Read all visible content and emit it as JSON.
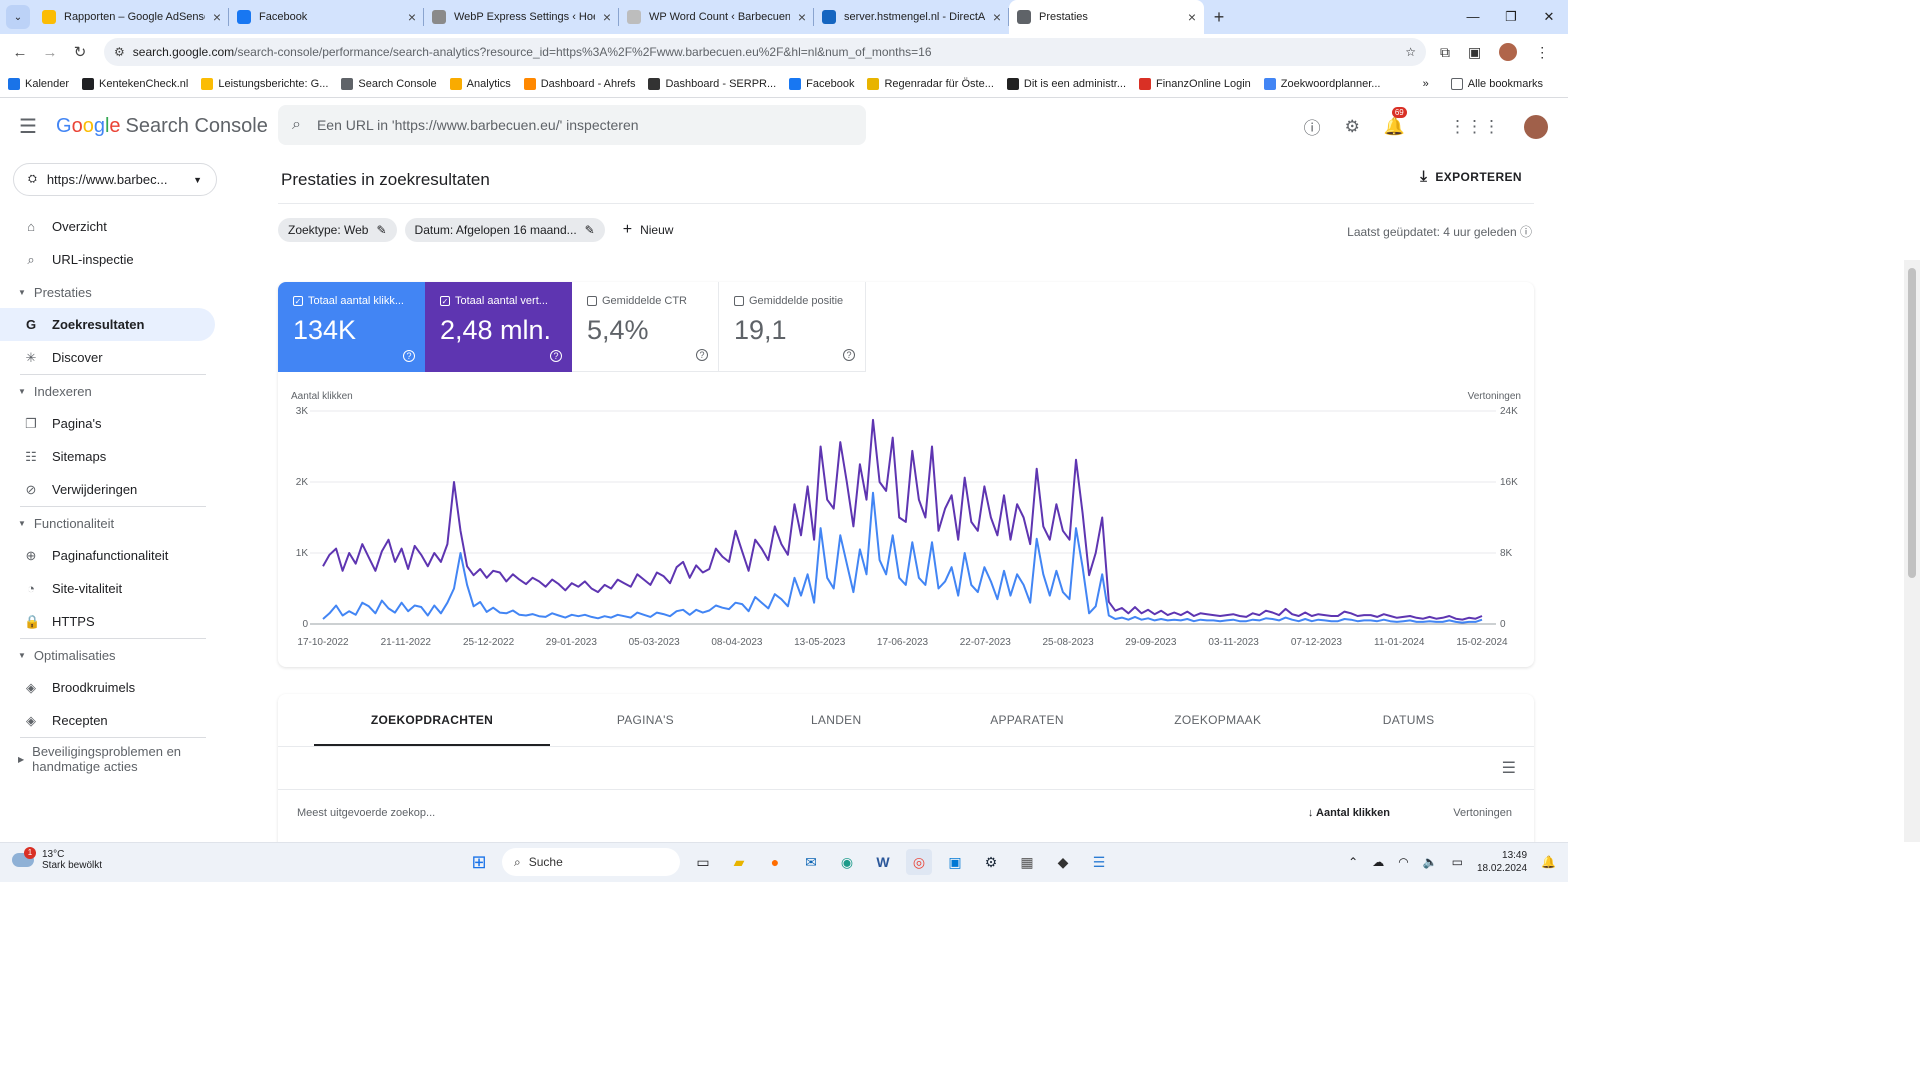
{
  "browser": {
    "tabs": [
      {
        "title": "Rapporten – Google AdSense",
        "color": "#fbbc04",
        "active": false
      },
      {
        "title": "Facebook",
        "color": "#1877f2",
        "active": false
      },
      {
        "title": "WebP Express Settings ‹ Hoe la",
        "color": "#8a8a8a",
        "active": false
      },
      {
        "title": "WP Word Count ‹ Barbecuen.eu",
        "color": "#bdbdbd",
        "active": false
      },
      {
        "title": "server.hstmengel.nl - DirectAdm",
        "color": "#1565c0",
        "active": false
      },
      {
        "title": "Prestaties",
        "color": "#5f6368",
        "active": true
      }
    ],
    "url_host": "search.google.com",
    "url_path": "/search-console/performance/search-analytics?resource_id=https%3A%2F%2Fwww.barbecuen.eu%2F&hl=nl&num_of_months=16",
    "bookmarks": [
      {
        "label": "Kalender",
        "color": "#1a73e8"
      },
      {
        "label": "KentekenCheck.nl",
        "color": "#202124"
      },
      {
        "label": "Leistungsberichte: G...",
        "color": "#fbbc04"
      },
      {
        "label": "Search Console",
        "color": "#5f6368"
      },
      {
        "label": "Analytics",
        "color": "#f9ab00"
      },
      {
        "label": "Dashboard - Ahrefs",
        "color": "#ff8800"
      },
      {
        "label": "Dashboard - SERPR...",
        "color": "#333333"
      },
      {
        "label": "Facebook",
        "color": "#1877f2"
      },
      {
        "label": "Regenradar für Öste...",
        "color": "#e8b400"
      },
      {
        "label": "Dit is een administr...",
        "color": "#222222"
      },
      {
        "label": "FinanzOnline Login",
        "color": "#d93025"
      },
      {
        "label": "Zoekwoordplanner...",
        "color": "#4285f4"
      }
    ],
    "all_bookmarks": "Alle bookmarks"
  },
  "header": {
    "logo_google": "Google",
    "logo_product": "Search Console",
    "search_placeholder": "Een URL in 'https://www.barbecuen.eu/' inspecteren",
    "notifications": "69"
  },
  "sidebar": {
    "property": "https://www.barbec...",
    "items": [
      {
        "type": "item",
        "label": "Overzicht",
        "icon": "home-icon",
        "glyph": "⌂"
      },
      {
        "type": "item",
        "label": "URL-inspectie",
        "icon": "search-icon",
        "glyph": "⌕"
      },
      {
        "type": "section",
        "label": "Prestaties"
      },
      {
        "type": "item",
        "label": "Zoekresultaten",
        "icon": "google-g-icon",
        "glyph": "G",
        "active": true
      },
      {
        "type": "item",
        "label": "Discover",
        "icon": "asterisk-icon",
        "glyph": "✳"
      },
      {
        "type": "section",
        "label": "Indexeren"
      },
      {
        "type": "item",
        "label": "Pagina's",
        "icon": "pages-icon",
        "glyph": "❐"
      },
      {
        "type": "item",
        "label": "Sitemaps",
        "icon": "sitemap-icon",
        "glyph": "☷"
      },
      {
        "type": "item",
        "label": "Verwijderingen",
        "icon": "eye-off-icon",
        "glyph": "⊘"
      },
      {
        "type": "section",
        "label": "Functionaliteit"
      },
      {
        "type": "item",
        "label": "Paginafunctionaliteit",
        "icon": "plus-circle-icon",
        "glyph": "⊕"
      },
      {
        "type": "item",
        "label": "Site-vitaliteit",
        "icon": "speed-icon",
        "glyph": "◔"
      },
      {
        "type": "item",
        "label": "HTTPS",
        "icon": "lock-icon",
        "glyph": "🔒"
      },
      {
        "type": "section",
        "label": "Optimalisaties"
      },
      {
        "type": "item",
        "label": "Broodkruimels",
        "icon": "layers-icon",
        "glyph": "◈"
      },
      {
        "type": "item",
        "label": "Recepten",
        "icon": "layers-icon",
        "glyph": "◈"
      },
      {
        "type": "section",
        "label": "Beveiligingsproblemen en handmatige acties"
      }
    ]
  },
  "main": {
    "title": "Prestaties in zoekresultaten",
    "export": "EXPORTEREN",
    "filters": [
      "Zoektype: Web",
      "Datum: Afgelopen 16 maand..."
    ],
    "new_label": "Nieuw",
    "updated": "Laatst geüpdatet: 4 uur geleden",
    "metrics": [
      {
        "label": "Totaal aantal klikk...",
        "value": "134K",
        "checked": true,
        "color": "#4285f4"
      },
      {
        "label": "Totaal aantal vert...",
        "value": "2,48 mln.",
        "checked": true,
        "color": "#5e35b1"
      },
      {
        "label": "Gemiddelde CTR",
        "value": "5,4%",
        "checked": false
      },
      {
        "label": "Gemiddelde positie",
        "value": "19,1",
        "checked": false
      }
    ],
    "tabs": [
      "ZOEKOPDRACHTEN",
      "PAGINA'S",
      "LANDEN",
      "APPARATEN",
      "ZOEKOPMAAK",
      "DATUMS"
    ],
    "table": {
      "col_query": "Meest uitgevoerde zoekop...",
      "col_clicks": "Aantal klikken",
      "col_impr": "Vertoningen"
    }
  },
  "chart_data": {
    "type": "line",
    "ylabel_left": "Aantal klikken",
    "ylabel_right": "Vertoningen",
    "ylim_left": [
      0,
      3000
    ],
    "ylim_right": [
      0,
      24000
    ],
    "yticks_left": [
      "0",
      "1K",
      "2K",
      "3K"
    ],
    "yticks_right": [
      "0",
      "8K",
      "16K",
      "24K"
    ],
    "xticks": [
      "17-10-2022",
      "21-11-2022",
      "25-12-2022",
      "29-01-2023",
      "05-03-2023",
      "08-04-2023",
      "13-05-2023",
      "17-06-2023",
      "22-07-2023",
      "25-08-2023",
      "29-09-2023",
      "03-11-2023",
      "07-12-2023",
      "11-01-2024",
      "15-02-2024"
    ],
    "grid": true,
    "series": [
      {
        "axis": "right",
        "color": "#5e35b1",
        "values": [
          6500,
          7800,
          8500,
          6000,
          8000,
          6800,
          9000,
          7500,
          6000,
          8200,
          9500,
          7000,
          8500,
          6200,
          8800,
          7800,
          6500,
          8000,
          7000,
          9000,
          16000,
          10500,
          6500,
          5500,
          6200,
          5200,
          6000,
          5800,
          4800,
          5600,
          5000,
          4500,
          5200,
          4800,
          4200,
          5000,
          4500,
          3800,
          4600,
          4200,
          4800,
          4000,
          3600,
          4400,
          4000,
          5000,
          4600,
          4200,
          5600,
          5000,
          4400,
          5800,
          5400,
          4600,
          6400,
          7000,
          5200,
          6600,
          5800,
          6200,
          8500,
          7600,
          7000,
          10500,
          8200,
          6000,
          9500,
          8500,
          7200,
          11000,
          9000,
          7800,
          13500,
          10000,
          15500,
          9500,
          20000,
          14000,
          13000,
          20500,
          16000,
          11000,
          18000,
          14000,
          23000,
          16000,
          15000,
          21000,
          12000,
          11500,
          19500,
          14000,
          12000,
          20000,
          10500,
          13000,
          14500,
          9500,
          16500,
          11500,
          10500,
          15500,
          12000,
          10000,
          14500,
          9500,
          13500,
          12000,
          9000,
          17500,
          11000,
          9500,
          13500,
          10500,
          9500,
          18500,
          12500,
          5500,
          8000,
          12000,
          2500,
          1500,
          1800,
          1200,
          1900,
          1200,
          1600,
          1100,
          1500,
          1000,
          1300,
          1000,
          1400,
          900,
          1200,
          1100,
          1000,
          900,
          1000,
          1100,
          900,
          800,
          1200,
          1000,
          1500,
          1300,
          1000,
          1700,
          1100,
          900,
          1300,
          900,
          1100,
          1000,
          900,
          900,
          1400,
          1200,
          900,
          1000,
          1000,
          800,
          1100,
          900,
          700,
          800,
          900,
          700,
          600,
          800,
          600,
          700,
          900,
          600,
          500,
          700,
          600,
          900
        ]
      },
      {
        "axis": "left",
        "color": "#4285f4",
        "values": [
          70,
          150,
          260,
          120,
          180,
          130,
          300,
          250,
          150,
          330,
          220,
          160,
          300,
          180,
          260,
          240,
          120,
          260,
          150,
          300,
          500,
          1000,
          550,
          250,
          310,
          170,
          230,
          160,
          150,
          190,
          130,
          120,
          140,
          110,
          100,
          150,
          120,
          90,
          130,
          110,
          130,
          100,
          80,
          110,
          90,
          130,
          110,
          90,
          160,
          130,
          100,
          160,
          140,
          110,
          180,
          200,
          130,
          200,
          160,
          190,
          260,
          230,
          210,
          300,
          280,
          180,
          380,
          300,
          220,
          420,
          350,
          250,
          650,
          400,
          700,
          300,
          1350,
          650,
          500,
          1250,
          850,
          450,
          1050,
          700,
          1850,
          900,
          700,
          1250,
          650,
          550,
          1150,
          650,
          550,
          1150,
          500,
          600,
          800,
          400,
          1000,
          550,
          450,
          800,
          600,
          350,
          750,
          400,
          700,
          550,
          300,
          1200,
          700,
          400,
          750,
          450,
          350,
          1350,
          800,
          150,
          250,
          700,
          120,
          70,
          90,
          60,
          100,
          60,
          80,
          50,
          70,
          50,
          60,
          50,
          70,
          40,
          60,
          50,
          50,
          40,
          50,
          60,
          40,
          40,
          60,
          50,
          80,
          70,
          50,
          90,
          60,
          40,
          70,
          40,
          60,
          50,
          40,
          40,
          70,
          60,
          40,
          50,
          50,
          40,
          60,
          40,
          30,
          40,
          50,
          30,
          30,
          40,
          30,
          30,
          50,
          30,
          20,
          30,
          30,
          60
        ]
      }
    ]
  }
}
